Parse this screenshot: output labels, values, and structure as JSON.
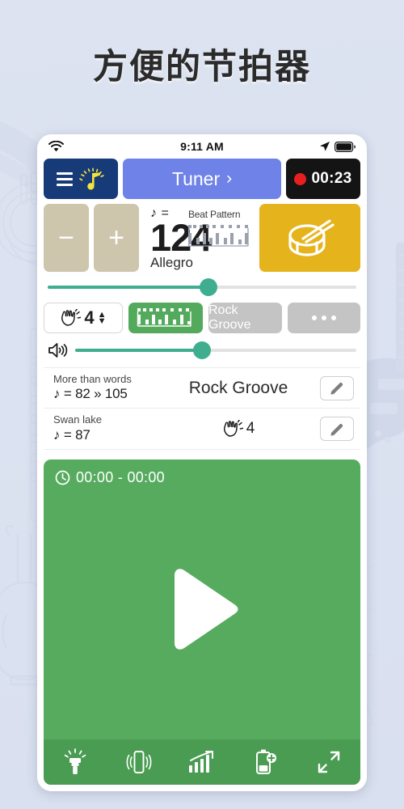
{
  "page": {
    "headline": "方便的节拍器",
    "background_color": "#dde3f0"
  },
  "statusbar": {
    "time": "9:11 AM",
    "icons": [
      "wifi-icon",
      "location-arrow-icon",
      "battery-icon"
    ]
  },
  "toolbar": {
    "menu_icon": "hamburger-menu-icon",
    "metronome_icon": "metronome-note-icon",
    "tuner_label": "Tuner",
    "tuner_chevron": "›",
    "record_time": "00:23",
    "record_dot_color": "#e81f1f",
    "menu_bg": "#173a78",
    "tuner_bg": "#6e82e8",
    "record_bg": "#141414"
  },
  "tempo": {
    "minus_label": "−",
    "plus_label": "+",
    "note_equals": "♪ =",
    "bpm": "124",
    "marking": "Allegro",
    "beat_pattern_label": "Beat Pattern",
    "drum_icon": "snare-drum-icon",
    "step_bg": "#cdc6ad",
    "drum_bg": "#e5b31c",
    "slider_percent": 52,
    "slider_color": "#3fae90"
  },
  "controls": {
    "hand_icon": "clap-hands-icon",
    "beats_value": "4",
    "spinner_up": "▲",
    "spinner_down": "▼",
    "pattern_icon": "rhythm-pattern-icon",
    "groove_label": "Rock Groove",
    "more_label": "•••",
    "pattern_bg": "#54aa5c",
    "groove_bg": "#c4c4c4"
  },
  "volume": {
    "speaker_icon": "speaker-volume-icon",
    "percent": 45,
    "color": "#3fae90"
  },
  "songs": [
    {
      "title": "More than words",
      "tempo": "♪ = 82 » 105",
      "middle_text": "Rock Groove",
      "middle_type": "text",
      "edit_icon": "pencil-edit-icon"
    },
    {
      "title": "Swan lake",
      "tempo": "♪ = 87",
      "middle_text": "4",
      "middle_type": "beats",
      "edit_icon": "pencil-edit-icon"
    }
  ],
  "player": {
    "clock_icon": "clock-icon",
    "time_range": "00:00 - 00:00",
    "play_icon": "play-triangle-icon",
    "panel_bg": "#57ab5e",
    "bottombar_bg": "#4a9c52"
  },
  "bottombar": {
    "items": [
      {
        "icon": "flashlight-icon",
        "label": "Flashlight"
      },
      {
        "icon": "vibrate-icon",
        "label": "Vibration"
      },
      {
        "icon": "tempo-increase-chart-icon",
        "label": "Tempo trainer"
      },
      {
        "icon": "battery-saver-icon",
        "label": "Battery"
      },
      {
        "icon": "fullscreen-expand-icon",
        "label": "Fullscreen"
      }
    ]
  }
}
